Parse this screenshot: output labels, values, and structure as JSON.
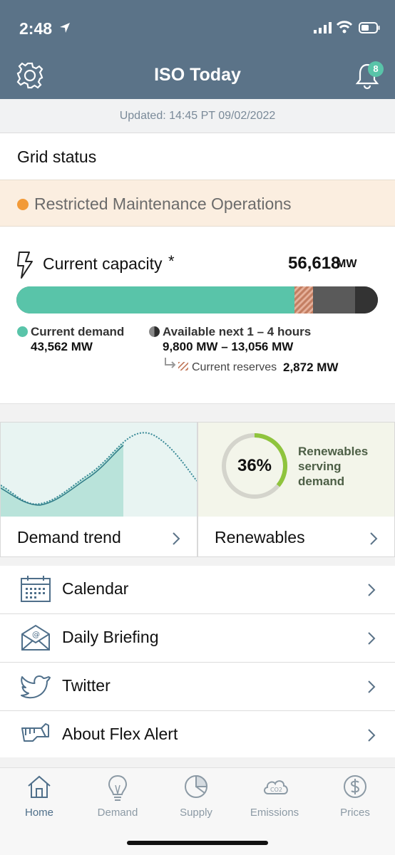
{
  "status_bar": {
    "time": "2:48"
  },
  "header": {
    "title": "ISO Today",
    "notification_count": "8",
    "icons": [
      "settings-gear-icon",
      "notification-bell-icon"
    ]
  },
  "updated": "Updated: 14:45 PT 09/02/2022",
  "grid_status": {
    "heading": "Grid status",
    "status": "Restricted Maintenance Operations",
    "status_color": "#f29a38"
  },
  "capacity": {
    "label": "Current capacity",
    "asterisk": "*",
    "value": "56,618",
    "unit": "MW",
    "bar": {
      "total_mw": 56618,
      "demand_mw": 43562,
      "reserves_mw": 2872
    },
    "demand_label": "Current demand",
    "demand_value": "43,562 MW",
    "available_label": "Available next 1 – 4 hours",
    "available_value": "9,800 MW – 13,056 MW",
    "reserves_label": "Current reserves",
    "reserves_value": "2,872 MW"
  },
  "tiles": {
    "demand": {
      "label": "Demand trend"
    },
    "renewables": {
      "label": "Renewables",
      "percent": "36%",
      "percent_value": 36,
      "caption": "Renewables serving demand"
    }
  },
  "menu": [
    {
      "label": "Calendar",
      "icon": "calendar-icon"
    },
    {
      "label": "Daily Briefing",
      "icon": "email-envelope-icon"
    },
    {
      "label": "Twitter",
      "icon": "twitter-bird-icon"
    },
    {
      "label": "About Flex Alert",
      "icon": "flex-alert-hand-icon"
    }
  ],
  "tabs": [
    {
      "label": "Home",
      "icon": "home-icon",
      "active": true
    },
    {
      "label": "Demand",
      "icon": "lightbulb-icon",
      "active": false
    },
    {
      "label": "Supply",
      "icon": "pie-chart-icon",
      "active": false
    },
    {
      "label": "Emissions",
      "icon": "co2-cloud-icon",
      "active": false
    },
    {
      "label": "Prices",
      "icon": "dollar-icon",
      "active": false
    }
  ],
  "colors": {
    "header": "#5b7388",
    "demand": "#59c4a9",
    "renewables_ring": "#8fc43d",
    "alert_bg": "#fbeee0"
  }
}
